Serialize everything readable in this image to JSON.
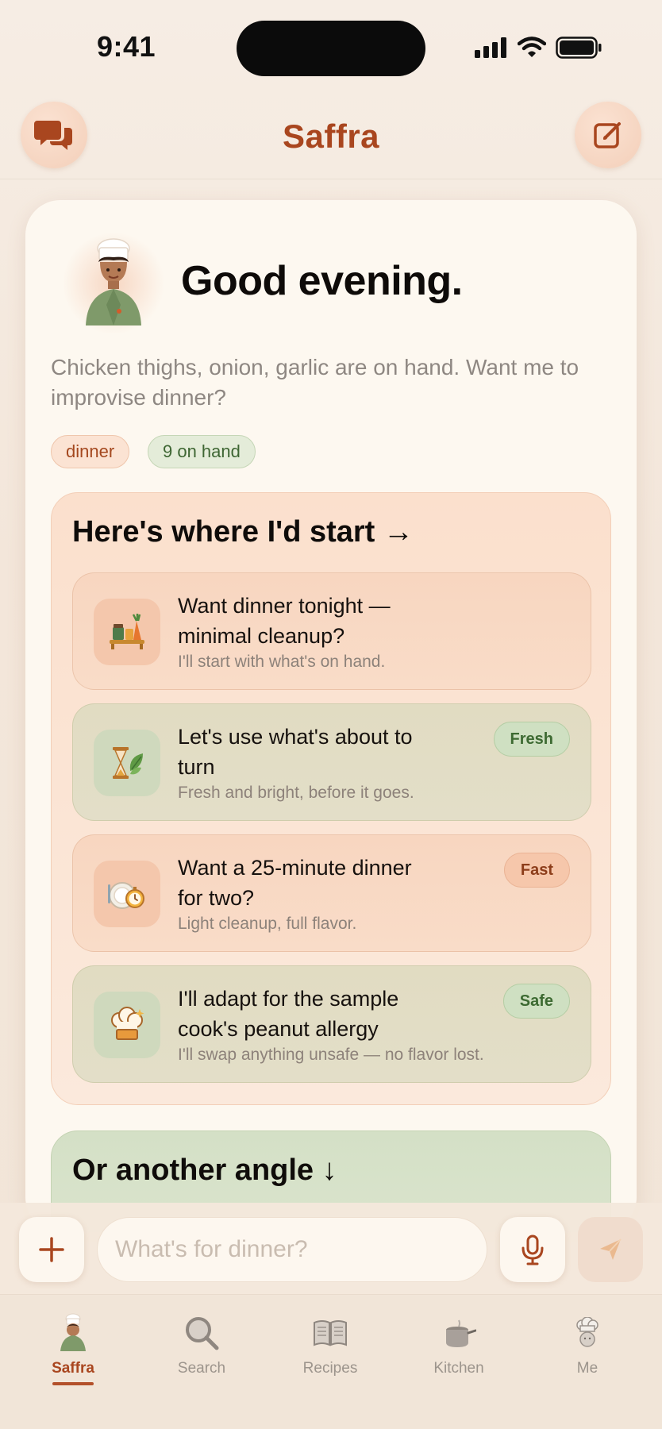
{
  "status_bar": {
    "time": "9:41"
  },
  "header": {
    "title": "Saffra",
    "left_icon": "chat-bubbles-icon",
    "right_icon": "compose-icon"
  },
  "hero": {
    "greeting": "Good evening.",
    "subtitle": "Chicken thighs, onion, garlic are on hand. Want me to improvise dinner?",
    "chips": [
      {
        "label": "dinner"
      },
      {
        "label": "9 on hand"
      }
    ]
  },
  "suggestions": {
    "title": "Here's where I'd start →",
    "items": [
      {
        "title": "Want dinner tonight — minimal cleanup?",
        "subtitle": "I'll start with what's on hand.",
        "badge": "",
        "icon": "pantry-shelf-icon"
      },
      {
        "title": "Let's use what's about to turn",
        "subtitle": "Fresh and bright, before it goes.",
        "badge": "Fresh",
        "icon": "hourglass-leaf-icon"
      },
      {
        "title": "Want a 25-minute dinner for two?",
        "subtitle": "Light cleanup, full flavor.",
        "badge": "Fast",
        "icon": "plate-timer-icon"
      },
      {
        "title": "I'll adapt for the sample cook's peanut allergy",
        "subtitle": "I'll swap anything unsafe — no flavor lost.",
        "badge": "Safe",
        "icon": "chef-hat-icon"
      }
    ]
  },
  "another_angle": {
    "title": "Or another angle ↓"
  },
  "composer": {
    "placeholder": "What's for dinner?"
  },
  "tabbar": {
    "tabs": [
      {
        "label": "Saffra",
        "active": true
      },
      {
        "label": "Search",
        "active": false
      },
      {
        "label": "Recipes",
        "active": false
      },
      {
        "label": "Kitchen",
        "active": false
      },
      {
        "label": "Me",
        "active": false
      }
    ]
  },
  "colors": {
    "brand": "#a9461f",
    "background": "#f6ede4",
    "card": "#fdf8f0",
    "peach_tile": "#f8d6c0",
    "green_tile": "#e1dcc2"
  }
}
